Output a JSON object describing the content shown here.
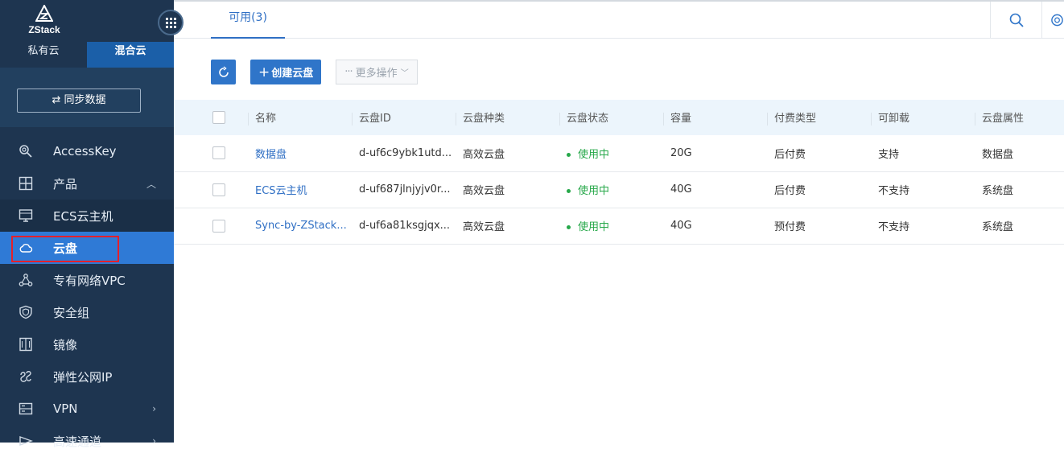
{
  "sidebar": {
    "logo_text": "ZStack",
    "cloud_tabs": [
      "私有云",
      "混合云"
    ],
    "sync_label": "⇄ 同步数据",
    "items": [
      {
        "label": "AccessKey",
        "icon": "key-search-icon"
      },
      {
        "label": "产品",
        "icon": "grid-product-icon",
        "expanded": true
      },
      {
        "label": "ECS云主机",
        "icon": "monitor-icon"
      },
      {
        "label": "云盘",
        "icon": "cloud-icon",
        "active": true
      },
      {
        "label": "专有网络VPC",
        "icon": "network-icon"
      },
      {
        "label": "安全组",
        "icon": "shield-icon"
      },
      {
        "label": "镜像",
        "icon": "image-icon"
      },
      {
        "label": "弹性公网IP",
        "icon": "elastic-ip-icon"
      },
      {
        "label": "VPN",
        "icon": "vpn-icon"
      },
      {
        "label": "高速通道",
        "icon": "express-icon"
      }
    ]
  },
  "tabs": {
    "available": "可用(3)"
  },
  "toolbar": {
    "create_label": "创建云盘",
    "more_label": "更多操作"
  },
  "table": {
    "headers": [
      "名称",
      "云盘ID",
      "云盘种类",
      "云盘状态",
      "容量",
      "付费类型",
      "可卸载",
      "云盘属性"
    ],
    "rows": [
      {
        "name": "数据盘",
        "id": "d-uf6c9ybk1utd...",
        "type": "高效云盘",
        "status": "使用中",
        "capacity": "20G",
        "pay": "后付费",
        "unmountable": "支持",
        "attr": "数据盘"
      },
      {
        "name": "ECS云主机",
        "id": "d-uf687jlnjyjv0r...",
        "type": "高效云盘",
        "status": "使用中",
        "capacity": "40G",
        "pay": "后付费",
        "unmountable": "不支持",
        "attr": "系统盘"
      },
      {
        "name": "Sync-by-ZStack...",
        "id": "d-uf6a81ksgjqx...",
        "type": "高效云盘",
        "status": "使用中",
        "capacity": "40G",
        "pay": "预付费",
        "unmountable": "不支持",
        "attr": "系统盘"
      }
    ]
  },
  "colors": {
    "accent": "#2f75c9",
    "sidebar": "#1e3550",
    "active_nav": "#2f7ad6",
    "status_ok": "#27a84a",
    "highlight": "#e5202a"
  }
}
